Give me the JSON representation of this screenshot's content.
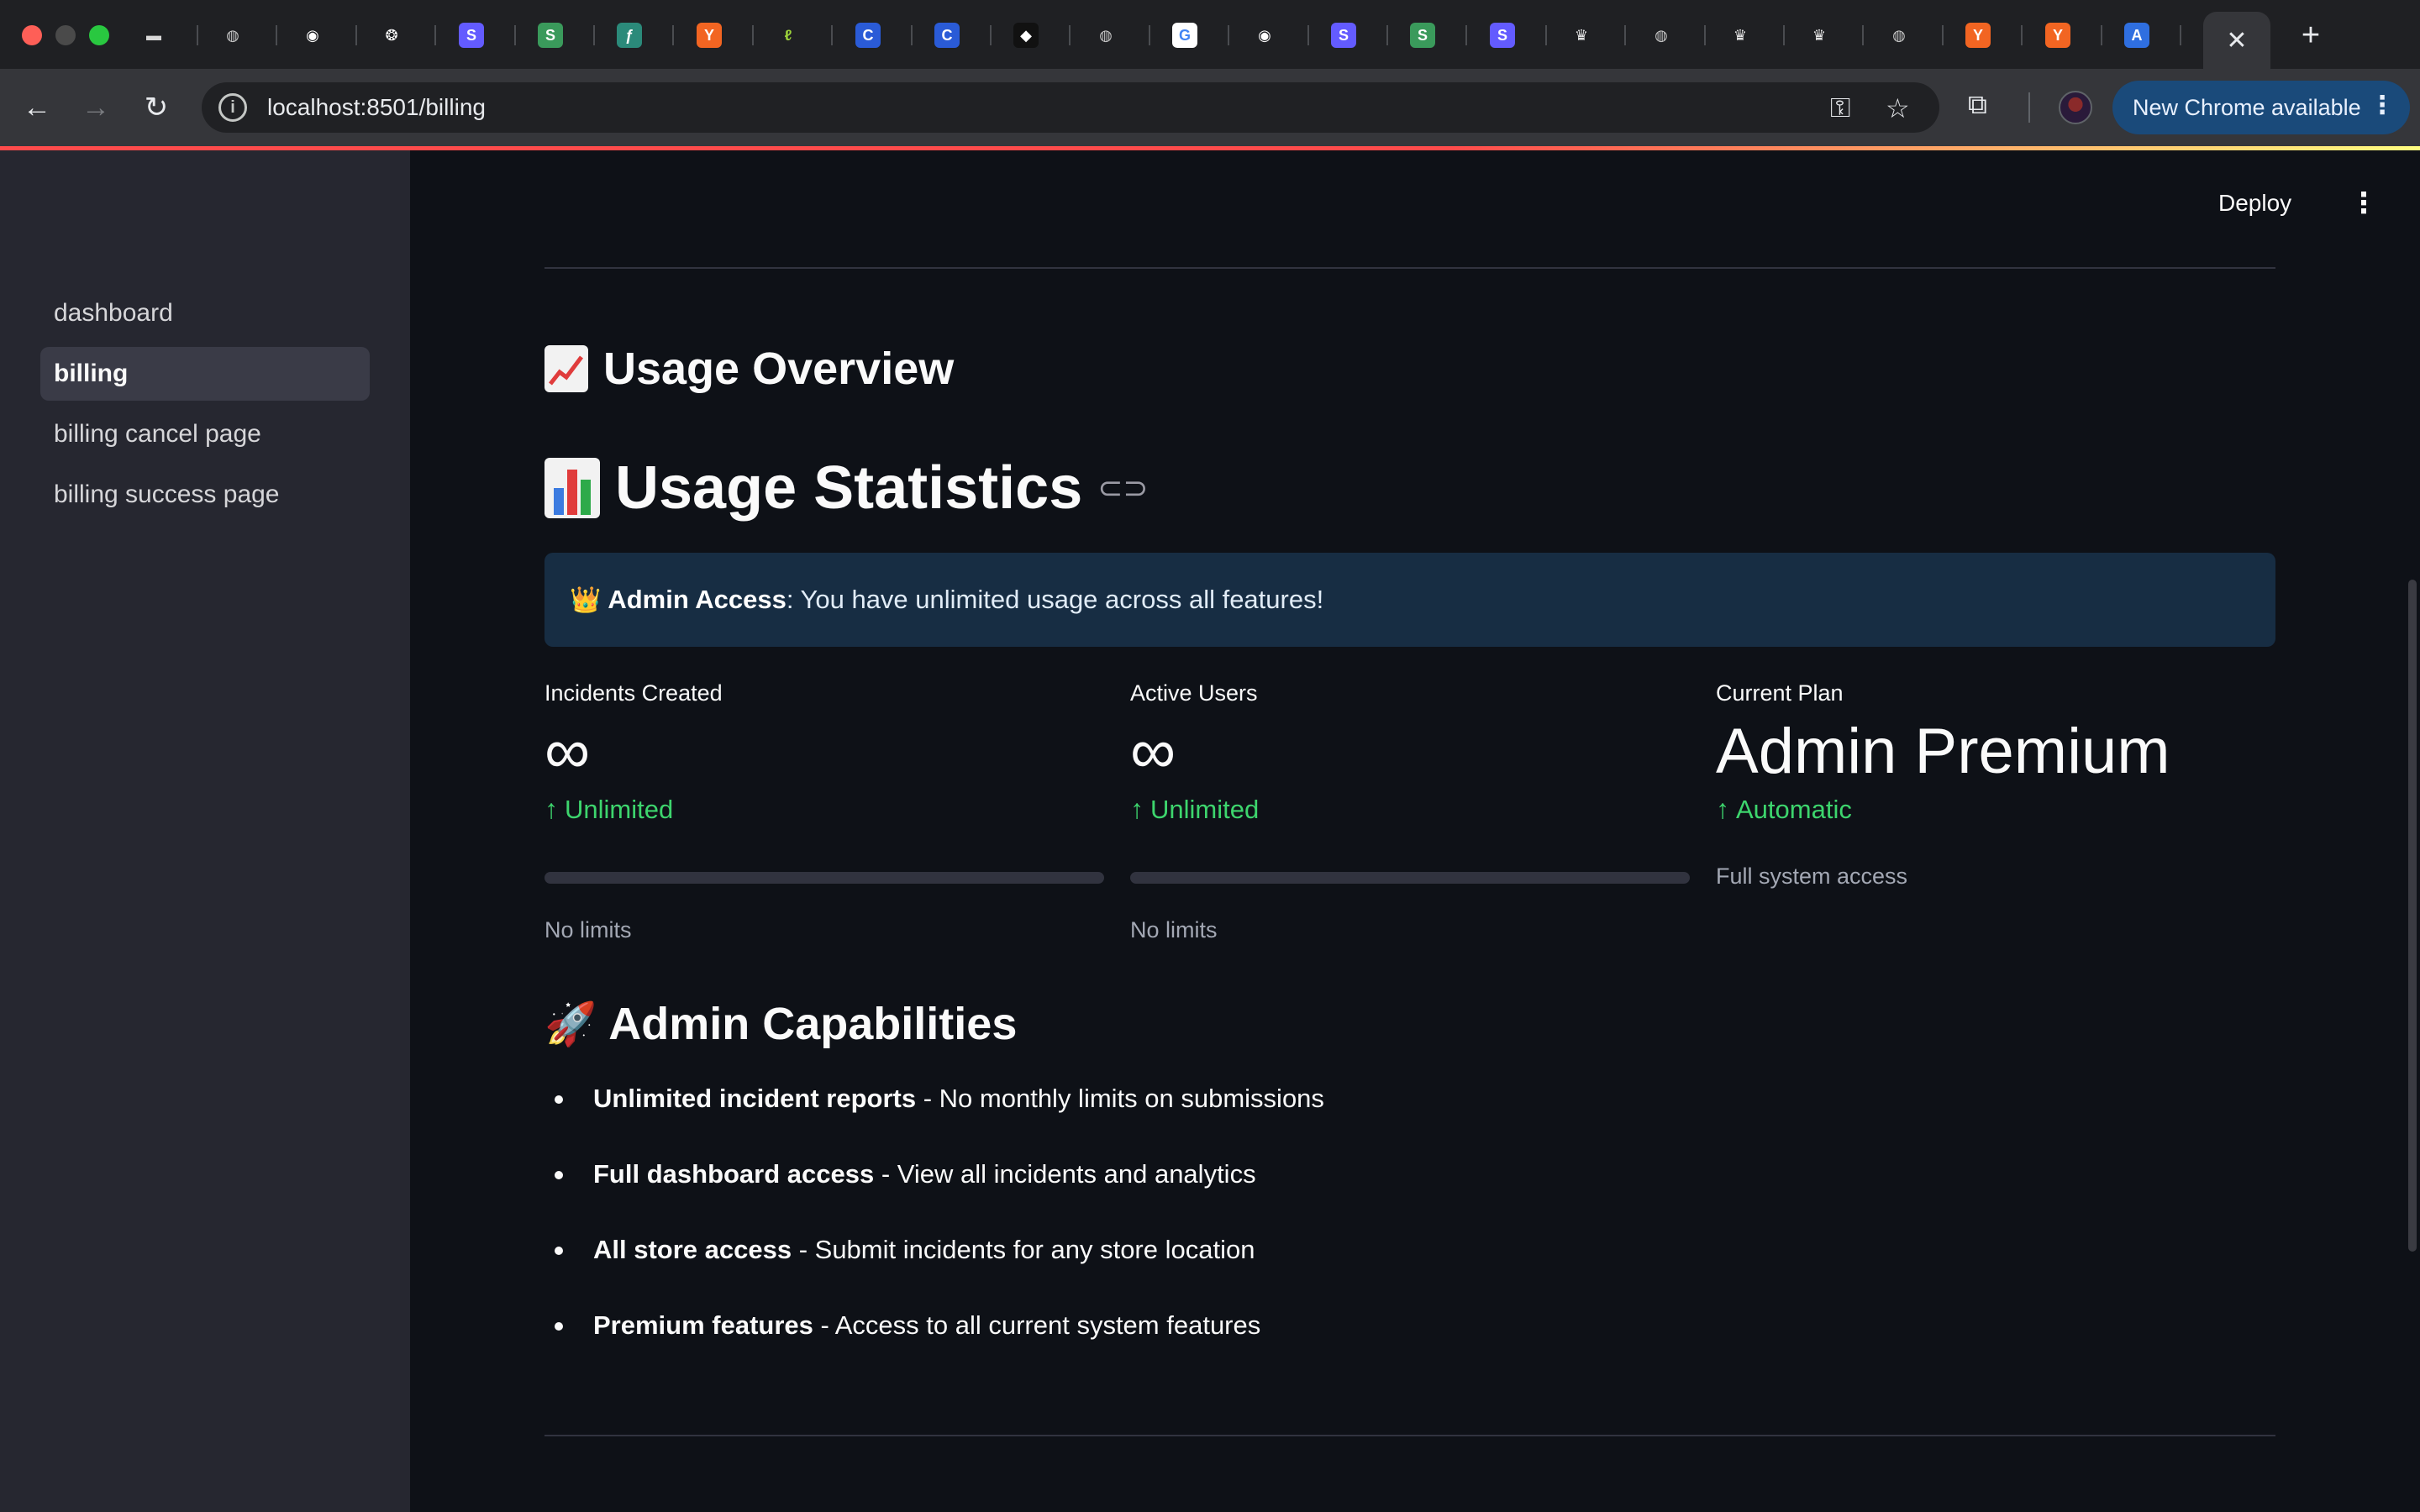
{
  "browser": {
    "url": "localhost:8501/billing",
    "update_label": "New Chrome available",
    "close_tab_glyph": "✕",
    "new_tab_glyph": "+",
    "tabs": [
      {
        "icon": "card-icon",
        "glyph": "▬",
        "color": "#d8d8d8",
        "bg": "transparent"
      },
      {
        "icon": "globe-icon",
        "glyph": "◍",
        "color": "#c8c8c8",
        "bg": "transparent"
      },
      {
        "icon": "github-icon",
        "glyph": "◉",
        "color": "#ffffff",
        "bg": "transparent"
      },
      {
        "icon": "openai-icon",
        "glyph": "❂",
        "color": "#ffffff",
        "bg": "transparent"
      },
      {
        "icon": "stripe-icon",
        "glyph": "S",
        "color": "#ffffff",
        "bg": "#635bff"
      },
      {
        "icon": "sheets-s-icon",
        "glyph": "S",
        "color": "#ffffff",
        "bg": "#3a9a5b"
      },
      {
        "icon": "feather-icon",
        "glyph": "ƒ",
        "color": "#ffffff",
        "bg": "#2b8a7a"
      },
      {
        "icon": "ycombinator-icon",
        "glyph": "Y",
        "color": "#ffffff",
        "bg": "#f26522"
      },
      {
        "icon": "replit-icon",
        "glyph": "ℓ",
        "color": "#9bd13a",
        "bg": "transparent"
      },
      {
        "icon": "coinbase-icon",
        "glyph": "C",
        "color": "#ffffff",
        "bg": "#2a5bd7"
      },
      {
        "icon": "coinbase-icon",
        "glyph": "C",
        "color": "#ffffff",
        "bg": "#2a5bd7"
      },
      {
        "icon": "cube-icon",
        "glyph": "◆",
        "color": "#ffffff",
        "bg": "#111111"
      },
      {
        "icon": "globe-icon",
        "glyph": "◍",
        "color": "#c8c8c8",
        "bg": "transparent"
      },
      {
        "icon": "google-icon",
        "glyph": "G",
        "color": "#4285f4",
        "bg": "#ffffff"
      },
      {
        "icon": "github-icon",
        "glyph": "◉",
        "color": "#ffffff",
        "bg": "transparent"
      },
      {
        "icon": "stripe-icon",
        "glyph": "S",
        "color": "#ffffff",
        "bg": "#635bff"
      },
      {
        "icon": "sheets-s-icon",
        "glyph": "S",
        "color": "#ffffff",
        "bg": "#3a9a5b"
      },
      {
        "icon": "stripe-icon",
        "glyph": "S",
        "color": "#ffffff",
        "bg": "#635bff"
      },
      {
        "icon": "crown-icon",
        "glyph": "♛",
        "color": "#e8e8e8",
        "bg": "transparent"
      },
      {
        "icon": "globe-icon",
        "glyph": "◍",
        "color": "#c8c8c8",
        "bg": "transparent"
      },
      {
        "icon": "crown-icon",
        "glyph": "♛",
        "color": "#e8e8e8",
        "bg": "transparent"
      },
      {
        "icon": "crown-icon",
        "glyph": "♛",
        "color": "#e8e8e8",
        "bg": "transparent"
      },
      {
        "icon": "globe-icon",
        "glyph": "◍",
        "color": "#c8c8c8",
        "bg": "transparent"
      },
      {
        "icon": "ycombinator-icon",
        "glyph": "Y",
        "color": "#ffffff",
        "bg": "#f26522"
      },
      {
        "icon": "ycombinator-icon",
        "glyph": "Y",
        "color": "#ffffff",
        "bg": "#f26522"
      },
      {
        "icon": "appstore-icon",
        "glyph": "A",
        "color": "#ffffff",
        "bg": "#2f6fe0"
      }
    ]
  },
  "sidebar": {
    "items": [
      {
        "label": "dashboard",
        "active": false
      },
      {
        "label": "billing",
        "active": true
      },
      {
        "label": "billing cancel page",
        "active": false
      },
      {
        "label": "billing success page",
        "active": false
      }
    ]
  },
  "header": {
    "deploy_label": "Deploy",
    "menu_glyph": "⋮"
  },
  "main": {
    "overview_title": "Usage Overview",
    "stats_title": "Usage Statistics",
    "alert": {
      "emoji": "👑",
      "bold": "Admin Access",
      "text": ": You have unlimited usage across all features!"
    },
    "metrics": [
      {
        "label": "Incidents Created",
        "value": "∞",
        "delta": "Unlimited",
        "delta_arrow": "↑",
        "progress": 0.0,
        "caption": "No limits"
      },
      {
        "label": "Active Users",
        "value": "∞",
        "delta": "Unlimited",
        "delta_arrow": "↑",
        "progress": 0.0,
        "caption": "No limits"
      },
      {
        "label": "Current Plan",
        "value": "Admin Premium",
        "delta": "Automatic",
        "delta_arrow": "↑",
        "caption": "Full system access"
      }
    ],
    "capabilities_emoji": "🚀",
    "capabilities_title": "Admin Capabilities",
    "capabilities": [
      {
        "bold": "Unlimited incident reports",
        "text": " - No monthly limits on submissions"
      },
      {
        "bold": "Full dashboard access",
        "text": " - View all incidents and analytics"
      },
      {
        "bold": "All store access",
        "text": " - Submit incidents for any store location"
      },
      {
        "bold": "Premium features",
        "text": " - Access to all current system features"
      }
    ]
  },
  "colors": {
    "accent_green": "#3dd56d",
    "alert_bg": "#172d43",
    "sidebar_bg": "#262730",
    "main_bg": "#0e1117"
  }
}
